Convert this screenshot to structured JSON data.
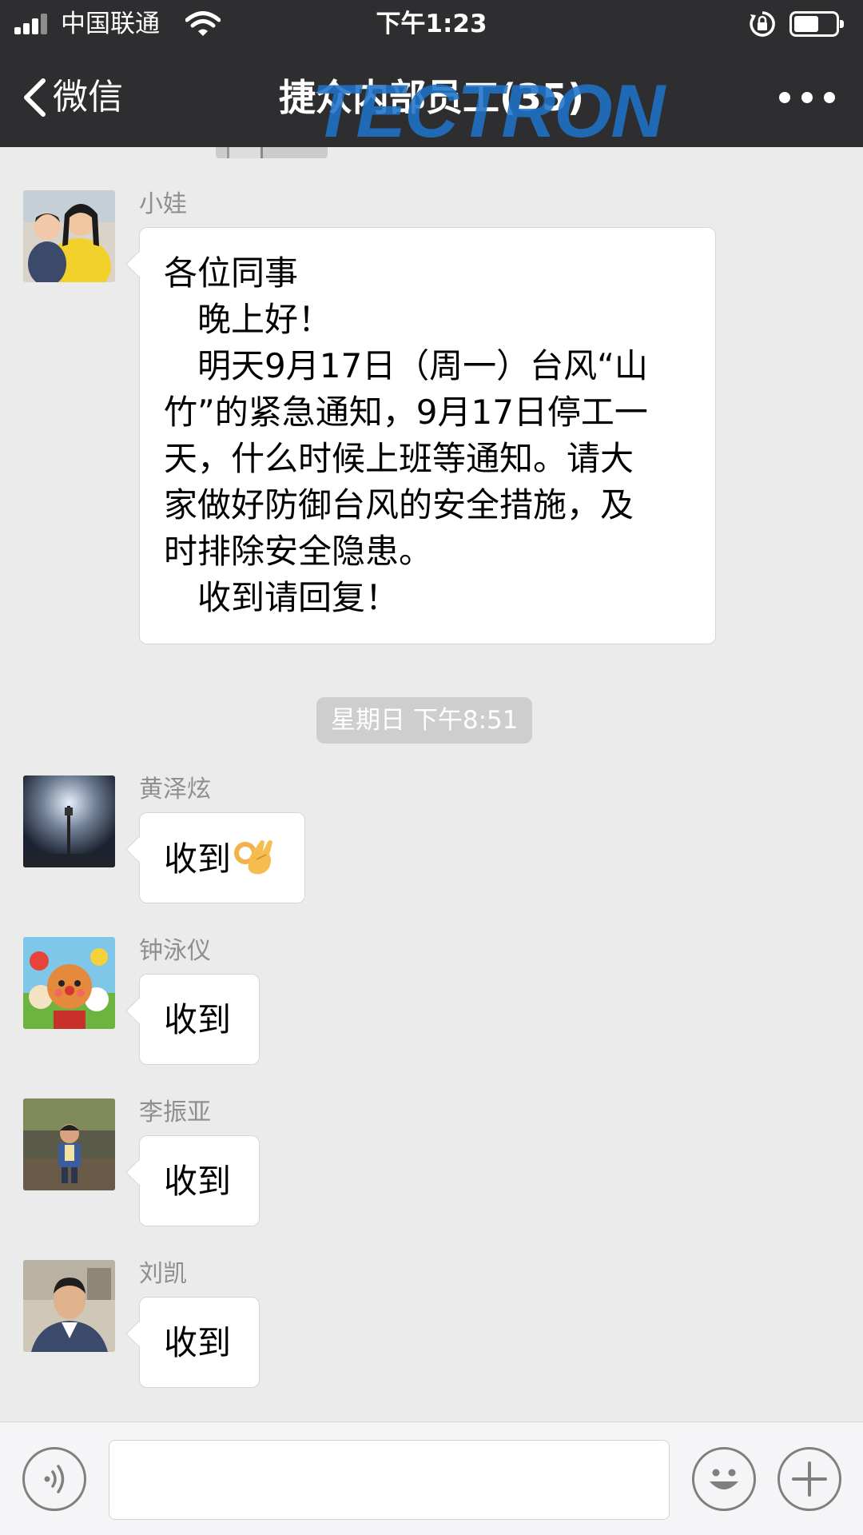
{
  "status_bar": {
    "carrier": "中国联通",
    "time": "下午1:23"
  },
  "nav": {
    "back_label": "微信",
    "title": "捷众内部员工(35)",
    "watermark": "TECTRON"
  },
  "messages": [
    {
      "sender": "小娃",
      "lines": [
        "各位同事",
        "　晚上好！",
        "　明天9月17日（周一）台风“山",
        "竹”的紧急通知，9月17日停工一",
        "天，什么时候上班等通知。请大",
        "家做好防御台风的安全措施，及",
        "时排除安全隐患。",
        "　收到请回复！"
      ]
    },
    {
      "sender": "黄泽炫",
      "text": "收到",
      "emoji": "ok-hand"
    },
    {
      "sender": "钟泳仪",
      "text": "收到"
    },
    {
      "sender": "李振亚",
      "text": "收到"
    },
    {
      "sender": "刘凯",
      "text": "收到"
    }
  ],
  "timestamp": "星期日 下午8:51",
  "input": {
    "value": ""
  },
  "colors": {
    "nav_bg": "#2e2e30",
    "chat_bg": "#ebebeb",
    "watermark": "#1f73c8"
  }
}
